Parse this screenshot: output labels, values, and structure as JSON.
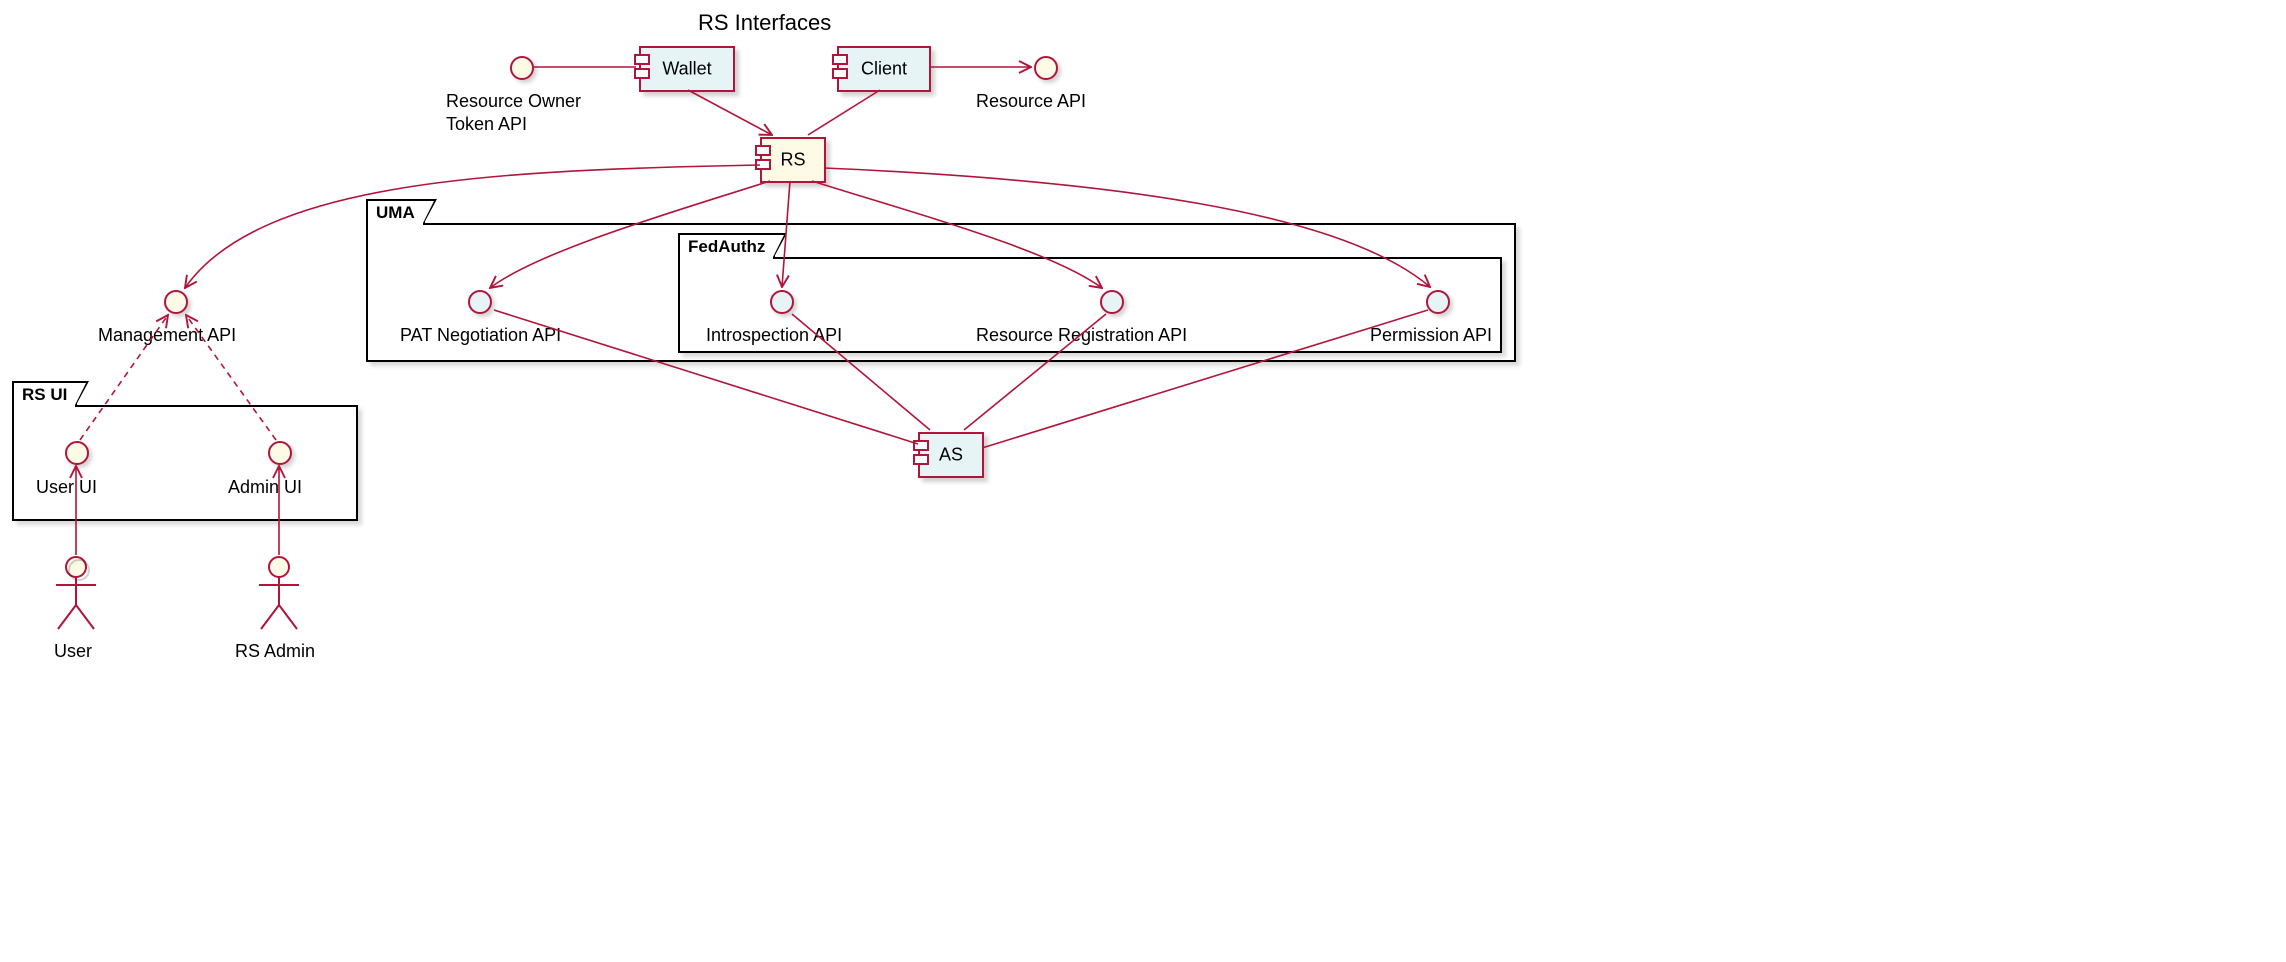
{
  "title": "RS Interfaces",
  "components": {
    "wallet": "Wallet",
    "client": "Client",
    "rs": "RS",
    "as": "AS"
  },
  "interfaces": {
    "ro_token": "Resource Owner\nToken API",
    "resource_api": "Resource API",
    "mgmt_api": "Management API",
    "pat": "PAT Negotiation API",
    "introspection": "Introspection API",
    "resreg": "Resource Registration API",
    "permission": "Permission API",
    "user_ui": "User UI",
    "admin_ui": "Admin UI"
  },
  "packages": {
    "uma": "UMA",
    "fedauthz": "FedAuthz",
    "rs_ui": "RS UI"
  },
  "actors": {
    "user": "User",
    "rs_admin": "RS Admin"
  }
}
